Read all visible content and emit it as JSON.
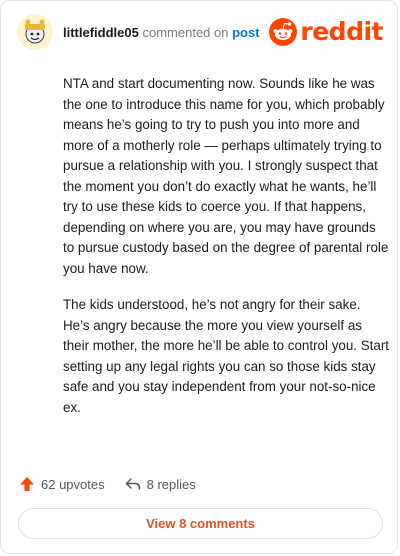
{
  "header": {
    "username": "littlefiddle05",
    "verb": "commented on",
    "post_link": "post",
    "logo_text": "reddit",
    "avatar_icon": "avatar-icon",
    "brand_color": "#ff4500"
  },
  "comment": {
    "paragraphs": [
      "NTA and start documenting now. Sounds like he was the one to introduce this name for you, which probably means he’s going to try to push you into more and more of a motherly role — perhaps ultimately trying to pursue a relationship with you. I strongly suspect that the moment you don’t do exactly what he wants, he’ll try to use these kids to coerce you. If that happens, depending on where you are, you may have grounds to pursue custody based on the degree of parental role you have now.",
      "The kids understood, he’s not angry for their sake. He’s angry because the more you view yourself as their mother, the more he’ll be able to control you. Start setting up any legal rights you can so those kids stay safe and you stay independent from your not-so-nice ex."
    ]
  },
  "actions": {
    "upvotes": "62 upvotes",
    "replies": "8 replies",
    "upvote_icon": "upvote-arrow-icon",
    "reply_icon": "reply-arrow-icon"
  },
  "footer": {
    "view_comments": "View 8 comments"
  }
}
